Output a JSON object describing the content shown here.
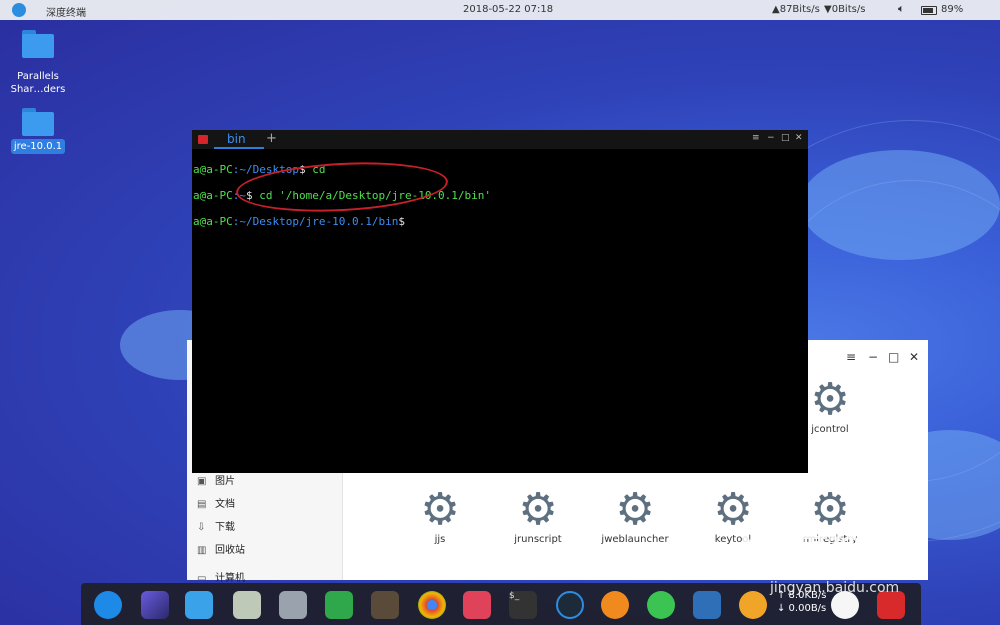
{
  "topbar": {
    "app_name": "深度终端",
    "datetime": "2018-05-22 07:18",
    "upload_speed": "87Bits/s",
    "download_speed": "0Bits/s",
    "battery": "89%"
  },
  "desktop_icons": [
    {
      "label": "Parallels Shar…ders"
    },
    {
      "label": "jre-10.0.1"
    }
  ],
  "terminal": {
    "tab_label": "bin",
    "lines": [
      {
        "user": "a@a-PC",
        "path": ":~/Desktop",
        "prompt": "$ ",
        "cmd": "cd"
      },
      {
        "user": "a@a-PC",
        "path": ":~",
        "prompt": "$ ",
        "cmd": "cd '/home/a/Desktop/jre-10.0.1/bin'"
      },
      {
        "user": "a@a-PC",
        "path": ":~/Desktop/jre-10.0.1/bin",
        "prompt": "$",
        "cmd": ""
      }
    ]
  },
  "file_manager": {
    "sidebar": [
      "图片",
      "文档",
      "下载",
      "回收站",
      "计算机"
    ],
    "files_top": [
      "jcontrol"
    ],
    "files_row": [
      "jjs",
      "jrunscript",
      "jweblauncher",
      "keytool",
      "rmiregistry"
    ]
  },
  "dock": {
    "upload": "↑ 8.0KB/s",
    "download": "↓ 0.00B/s"
  },
  "watermark": {
    "logo": "Bai度经验",
    "url": "jingyan.baidu.com"
  }
}
